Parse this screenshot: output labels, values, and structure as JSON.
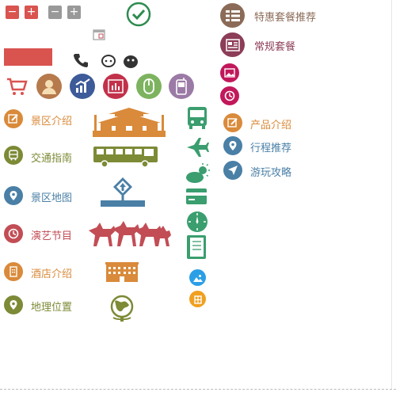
{
  "controls": {
    "minus": "−",
    "plus": "+"
  },
  "top_right": {
    "promo": "特惠套餐推荐",
    "regular": "常规套餐"
  },
  "left_menu": [
    {
      "label": "景区介绍",
      "icon": "edit-icon",
      "color": "#d98a3a"
    },
    {
      "label": "交通指南",
      "icon": "bus-icon",
      "color": "#7d8a36"
    },
    {
      "label": "景区地图",
      "icon": "map-pin-icon",
      "color": "#4a7fa6"
    },
    {
      "label": "演艺节目",
      "icon": "clock-icon",
      "color": "#c24d55"
    },
    {
      "label": "酒店介绍",
      "icon": "building-icon",
      "color": "#d98a3a"
    },
    {
      "label": "地理位置",
      "icon": "location-icon",
      "color": "#7d8a36"
    }
  ],
  "right_menu": [
    {
      "label": "产品介绍",
      "icon": "edit-icon",
      "color": "#d98a3a"
    },
    {
      "label": "行程推荐",
      "icon": "map-pin-icon",
      "color": "#4a7fa6"
    },
    {
      "label": "游玩攻略",
      "icon": "navigation-icon",
      "color": "#4a7fa6"
    }
  ],
  "colors": {
    "red": "#d9534f",
    "gray": "#999999",
    "orange": "#d98a3a",
    "olive": "#7d8a36",
    "blue": "#4a7fa6",
    "crimson": "#c24d55",
    "brown": "#8b6b58",
    "magenta": "#c2185b",
    "teal": "#3a9e6e"
  }
}
